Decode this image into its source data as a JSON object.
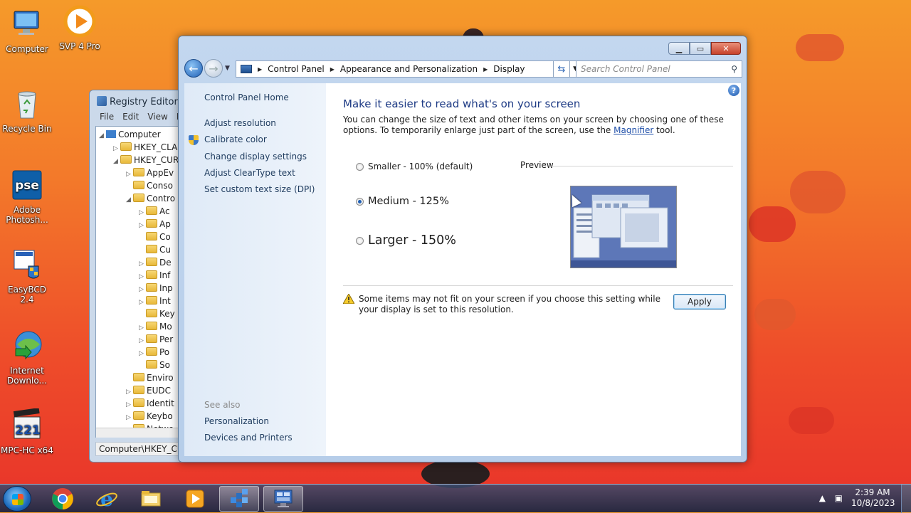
{
  "desktop": {
    "icons": [
      {
        "label": "Computer"
      },
      {
        "label": "SVP 4 Pro"
      },
      {
        "label": "Recycle Bin"
      },
      {
        "label": "Adobe Photosh..."
      },
      {
        "label": "EasyBCD 2.4"
      },
      {
        "label": "Internet Downlo..."
      },
      {
        "label": "MPC-HC x64"
      }
    ]
  },
  "regedit": {
    "title": "Registry Editor",
    "menu": [
      "File",
      "Edit",
      "View",
      "F"
    ],
    "tree": [
      {
        "label": "Computer",
        "exp": "◢"
      },
      {
        "label": "HKEY_CLA",
        "exp": "▷"
      },
      {
        "label": "HKEY_CUR",
        "exp": "◢"
      },
      {
        "label": "AppEv",
        "exp": "▷"
      },
      {
        "label": "Conso",
        "exp": ""
      },
      {
        "label": "Contro",
        "exp": "◢"
      },
      {
        "label": "Ac",
        "exp": "▷"
      },
      {
        "label": "Ap",
        "exp": "▷"
      },
      {
        "label": "Co",
        "exp": ""
      },
      {
        "label": "Cu",
        "exp": ""
      },
      {
        "label": "De",
        "exp": "▷"
      },
      {
        "label": "Inf",
        "exp": "▷"
      },
      {
        "label": "Inp",
        "exp": "▷"
      },
      {
        "label": "Int",
        "exp": "▷"
      },
      {
        "label": "Key",
        "exp": ""
      },
      {
        "label": "Mo",
        "exp": "▷"
      },
      {
        "label": "Per",
        "exp": "▷"
      },
      {
        "label": "Po",
        "exp": "▷"
      },
      {
        "label": "So",
        "exp": ""
      },
      {
        "label": "Enviro",
        "exp": ""
      },
      {
        "label": "EUDC",
        "exp": "▷"
      },
      {
        "label": "Identit",
        "exp": "▷"
      },
      {
        "label": "Keybo",
        "exp": "▷"
      },
      {
        "label": "Netwo",
        "exp": ""
      }
    ],
    "status": "Computer\\HKEY_CUR"
  },
  "controlpanel": {
    "address": {
      "crumbs": [
        "Control Panel",
        "Appearance and Personalization",
        "Display"
      ]
    },
    "search_placeholder": "Search Control Panel",
    "sidebar": {
      "home": "Control Panel Home",
      "links": [
        "Adjust resolution",
        "Calibrate color",
        "Change display settings",
        "Adjust ClearType text",
        "Set custom text size (DPI)"
      ],
      "see_also_label": "See also",
      "see_also": [
        "Personalization",
        "Devices and Printers"
      ]
    },
    "main": {
      "heading": "Make it easier to read what's on your screen",
      "desc_before": "You can change the size of text and other items on your screen by choosing one of these options. To temporarily enlarge just part of the screen, use the ",
      "desc_link": "Magnifier",
      "desc_after": " tool.",
      "options": [
        {
          "label": "Smaller - 100% (default)",
          "checked": false
        },
        {
          "label": "Medium - 125%",
          "checked": true
        },
        {
          "label": "Larger - 150%",
          "checked": false
        }
      ],
      "preview_label": "Preview",
      "warning": "Some items may not fit on your screen if you choose this setting while your display is set to this resolution.",
      "apply_label": "Apply"
    }
  },
  "taskbar": {
    "time": "2:39 AM",
    "date": "10/8/2023"
  }
}
